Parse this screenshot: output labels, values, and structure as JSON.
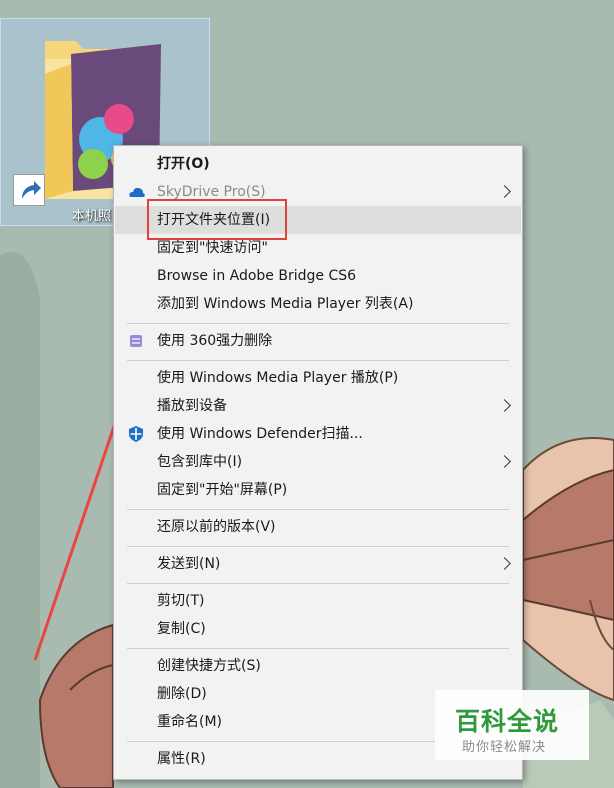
{
  "desktop_icon": {
    "label": "本机照"
  },
  "menu": {
    "items": [
      {
        "label": "打开(O)",
        "bold": true
      },
      {
        "label": "SkyDrive Pro(S)",
        "icon": "cloud-icon",
        "submenu": true,
        "disabled": true
      },
      {
        "label": "打开文件夹位置(I)",
        "highlighted": true
      },
      {
        "label": "固定到\"快速访问\""
      },
      {
        "label": "Browse in Adobe Bridge CS6"
      },
      {
        "label": "添加到 Windows Media Player 列表(A)"
      },
      {
        "label": "使用 360强力删除",
        "icon": "360-shredder-icon"
      },
      {
        "label": "使用 Windows Media Player 播放(P)"
      },
      {
        "label": "播放到设备",
        "submenu": true
      },
      {
        "label": "使用 Windows Defender扫描...",
        "icon": "defender-shield-icon"
      },
      {
        "label": "包含到库中(I)",
        "submenu": true
      },
      {
        "label": "固定到\"开始\"屏幕(P)"
      },
      {
        "label": "还原以前的版本(V)"
      },
      {
        "label": "发送到(N)",
        "submenu": true
      },
      {
        "label": "剪切(T)"
      },
      {
        "label": "复制(C)"
      },
      {
        "label": "创建快捷方式(S)"
      },
      {
        "label": "删除(D)"
      },
      {
        "label": "重命名(M)"
      },
      {
        "label": "属性(R)"
      }
    ]
  },
  "watermark": {
    "title": "百科全说",
    "subtitle": "助你轻松解决"
  },
  "colors": {
    "highlight_box": "#e0413e",
    "watermark_green": "#2f9a3c",
    "menu_bg": "#f2f2f2"
  }
}
